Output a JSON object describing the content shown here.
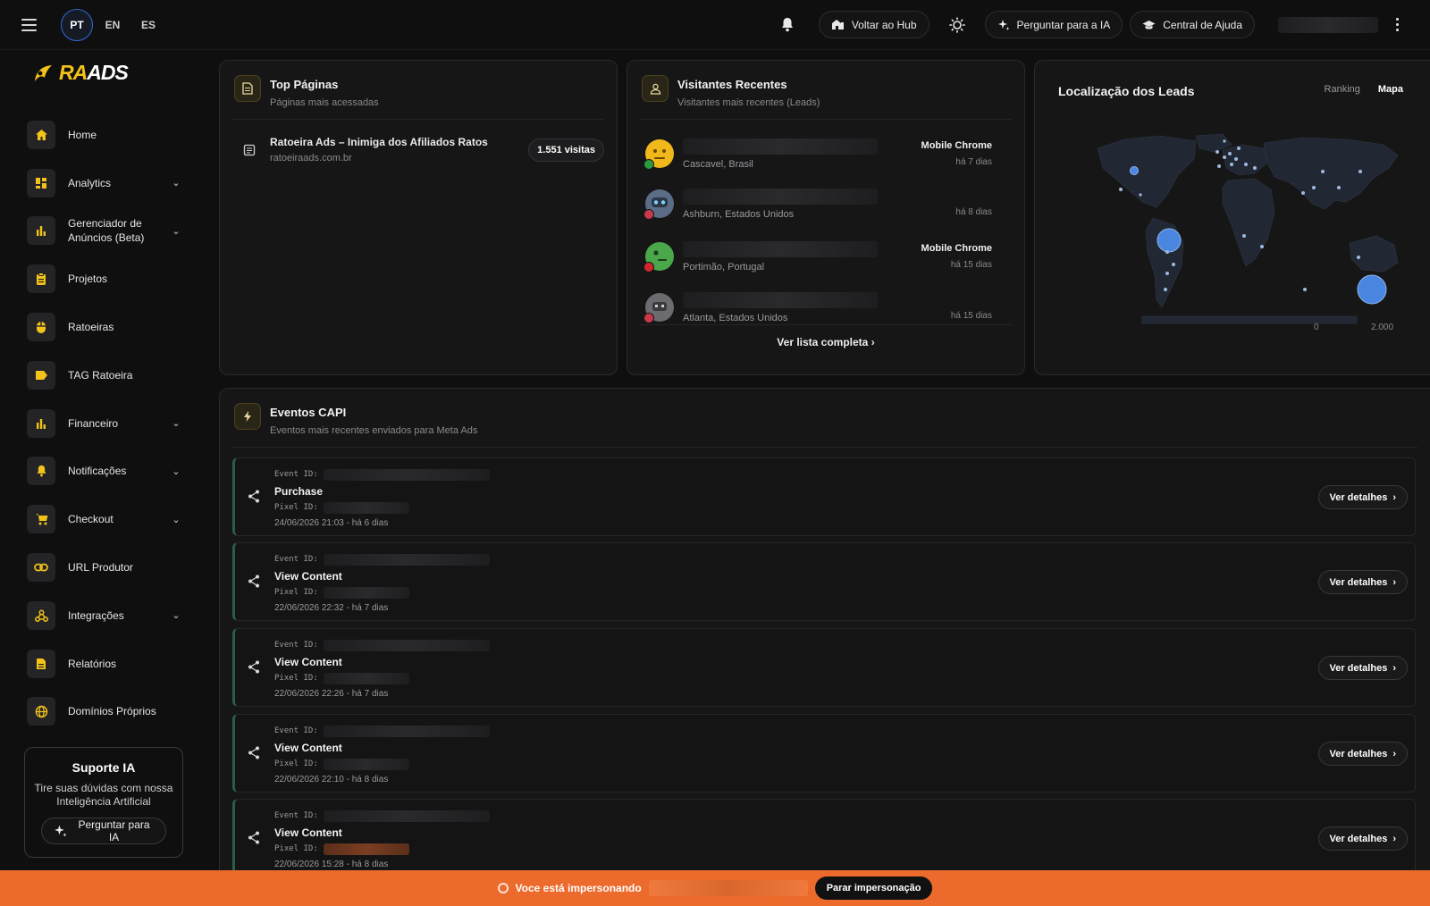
{
  "topbar": {
    "languages": [
      "PT",
      "EN",
      "ES"
    ],
    "active_language": "PT",
    "hub_label": "Voltar ao Hub",
    "ask_ai_label": "Perguntar para a IA",
    "help_label": "Central de Ajuda"
  },
  "sidebar": {
    "logo": "RAADS",
    "items": [
      {
        "label": "Home",
        "icon": "home-icon",
        "expandable": false
      },
      {
        "label": "Analytics",
        "icon": "analytics-icon",
        "expandable": true
      },
      {
        "label": "Gerenciador de Anúncios (Beta)",
        "icon": "bar-chart-icon",
        "expandable": true
      },
      {
        "label": "Projetos",
        "icon": "clipboard-icon",
        "expandable": false
      },
      {
        "label": "Ratoeiras",
        "icon": "mouse-icon",
        "expandable": false
      },
      {
        "label": "TAG Ratoeira",
        "icon": "tag-icon",
        "expandable": false
      },
      {
        "label": "Financeiro",
        "icon": "bar-chart-icon",
        "expandable": true
      },
      {
        "label": "Notificações",
        "icon": "bell-icon",
        "expandable": true
      },
      {
        "label": "Checkout",
        "icon": "cart-icon",
        "expandable": true
      },
      {
        "label": "URL Produtor",
        "icon": "link-icon",
        "expandable": false
      },
      {
        "label": "Integrações",
        "icon": "webhook-icon",
        "expandable": true
      },
      {
        "label": "Relatórios",
        "icon": "report-icon",
        "expandable": false
      },
      {
        "label": "Domínios Próprios",
        "icon": "globe-icon",
        "expandable": false
      }
    ],
    "support": {
      "title": "Suporte IA",
      "text": "Tire suas dúvidas com nossa Inteligência Artificial",
      "button": "Perguntar para IA"
    }
  },
  "top_pages": {
    "title": "Top Páginas",
    "subtitle": "Páginas mais acessadas",
    "rows": [
      {
        "title": "Ratoeira Ads – Inimiga dos Afiliados Ratos",
        "url": "ratoeiraads.com.br",
        "visits": "1.551 visitas"
      }
    ]
  },
  "recent_visitors": {
    "title": "Visitantes Recentes",
    "subtitle": "Visitantes mais recentes (Leads)",
    "rows": [
      {
        "location": "Cascavel, Brasil",
        "device": "Mobile Chrome",
        "time": "há 7 dias",
        "avatar_color": "#f1b81b",
        "flag_color": "#2e9a3e"
      },
      {
        "location": "Ashburn, Estados Unidos",
        "device": "",
        "time": "há 8 dias",
        "avatar_color": "#5b6d86",
        "flag_color": "#c8394a"
      },
      {
        "location": "Portimão, Portugal",
        "device": "Mobile Chrome",
        "time": "há 15 dias",
        "avatar_color": "#4aa84a",
        "flag_color": "#d1262e"
      },
      {
        "location": "Atlanta, Estados Unidos",
        "device": "",
        "time": "há 15 dias",
        "avatar_color": "#6b6b70",
        "flag_color": "#c8394a"
      }
    ],
    "view_all": "Ver lista completa"
  },
  "leads_location": {
    "title": "Localização dos Leads",
    "tabs": [
      "Ranking",
      "Mapa"
    ],
    "active_tab": "Mapa",
    "legend_min": "0",
    "legend_max": "2.000"
  },
  "capi": {
    "title": "Eventos CAPI",
    "subtitle": "Eventos mais recentes enviados para Meta Ads",
    "event_id_label": "Event ID:",
    "pixel_id_label": "Pixel ID:",
    "details_label": "Ver detalhes",
    "events": [
      {
        "name": "Purchase",
        "date": "24/06/2026 21:03 - há 6 dias"
      },
      {
        "name": "View Content",
        "date": "22/06/2026 22:32 - há 7 dias"
      },
      {
        "name": "View Content",
        "date": "22/06/2026 22:26 - há 7 dias"
      },
      {
        "name": "View Content",
        "date": "22/06/2026 22:10 - há 8 dias"
      },
      {
        "name": "View Content",
        "date": "22/06/2026 15:28 - há 8 dias"
      }
    ]
  },
  "banner": {
    "text": "Voce está impersonando",
    "button": "Parar impersonação"
  },
  "colors": {
    "accent": "#f2c318",
    "banner": "#ec6a2c",
    "map_dot": "#4a86e0"
  }
}
